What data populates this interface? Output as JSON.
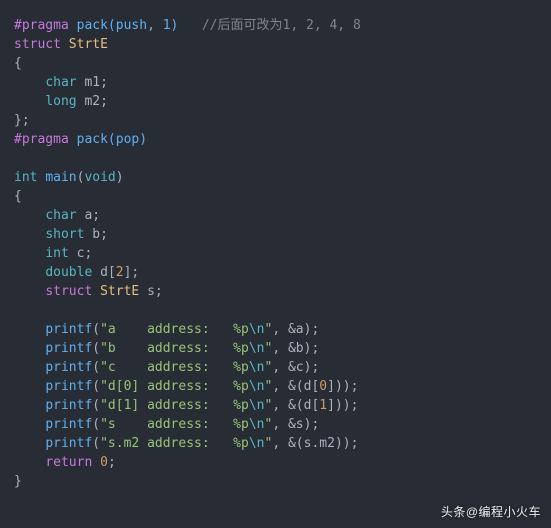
{
  "tok": {
    "pragma_push": "#pragma",
    "pack_push": "pack(push, 1)",
    "comment_push": "//后面可改为1, 2, 4, 8",
    "kw_struct": "struct",
    "ty_StrtE": "StrtE",
    "brace_open": "{",
    "brace_close": "};",
    "kw_char": "char",
    "kw_long": "long",
    "kw_short": "short",
    "kw_int": "int",
    "kw_double": "double",
    "kw_void": "void",
    "kw_return": "return",
    "m1": "m1",
    "m2": "m2",
    "semi": ";",
    "pragma_pop": "#pragma",
    "pack_pop": "pack(pop)",
    "fn_main": "main",
    "brace_open_fn": "{",
    "brace_close_fn": "}",
    "var_a": "a",
    "var_b": "b",
    "var_c": "c",
    "var_d": "d",
    "var_s": "s",
    "num_2": "2",
    "num_0": "0",
    "num_1": "1",
    "sq_open": "[",
    "sq_close": "]",
    "fn_printf": "printf",
    "paren_open": "(",
    "paren_close": ")",
    "comma": ", ",
    "amp": "&",
    "str_a": "\"a    address:   %p",
    "str_b": "\"b    address:   %p",
    "str_c": "\"c    address:   %p",
    "str_d0": "\"d[0] address:   %p",
    "str_d1": "\"d[1] address:   %p",
    "str_s": "\"s    address:   %p",
    "str_sm2": "\"s.m2 address:   %p",
    "str_end": "\"",
    "esc_n": "\\n",
    "dot": ".",
    "ret0": "0"
  },
  "watermark": "头条@编程小火车"
}
